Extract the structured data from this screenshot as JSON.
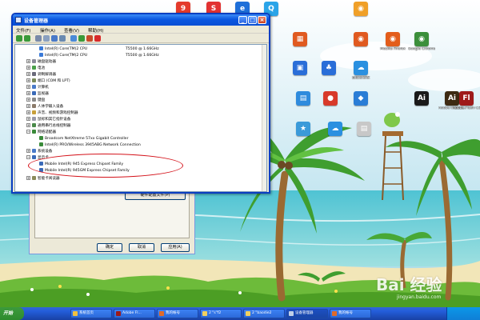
{
  "window": {
    "title": "设备管理器",
    "menu": [
      "文件(F)",
      "操作(A)",
      "查看(V)",
      "帮助(H)"
    ]
  },
  "tree": {
    "processors": [
      {
        "name": "Intel(R) Core(TM)2 CPU",
        "model": "T5500 @ 1.66GHz"
      },
      {
        "name": "Intel(R) Core(TM)2 CPU",
        "model": "T5500 @ 1.66GHz"
      }
    ],
    "categories": [
      "磁盘驱动器",
      "电池",
      "调制解调器",
      "端口 (COM 和 LPT)",
      "计算机",
      "监视器",
      "键盘",
      "人体学输入设备",
      "声音、视频和游戏控制器",
      "鼠标和其它指针设备",
      "通用串行总线控制器",
      "网络适配器"
    ],
    "network_devices": [
      "Broadcom NetXtreme 57xx Gigabit Controller",
      "Intel(R) PRO/Wireless 3945ABG Network Connection"
    ],
    "after_network": [
      "系统设备",
      "显示卡"
    ],
    "display_devices": [
      "Mobile Intel(R) 945 Express Chipset Family",
      "Mobile Intel(R) 945GM Express Chipset Family"
    ],
    "last_category": "智能卡阅读器"
  },
  "background_dialog": {
    "button_top": "硬件配置文件(P)",
    "buttons": [
      "确定",
      "取消",
      "应用(A)"
    ]
  },
  "desktop_icons": [
    {
      "label": "",
      "color": "#e43b2c",
      "glyph": "9"
    },
    {
      "label": "",
      "color": "#e23232",
      "glyph": "S"
    },
    {
      "label": "",
      "color": "#1e6fd9",
      "glyph": "e"
    },
    {
      "label": "",
      "color": "#2aa4e8",
      "glyph": "Q"
    },
    {
      "label": "",
      "color": "#f0a028",
      "glyph": "◉"
    },
    {
      "label": "",
      "color": "#e05a20",
      "glyph": "▦"
    },
    {
      "label": "",
      "color": "#e05a20",
      "glyph": "◉"
    },
    {
      "label": "Mozilla Firefox",
      "color": "#e35d1b",
      "glyph": "◉"
    },
    {
      "label": "Google Chrome",
      "color": "#3b8f3b",
      "glyph": "◉"
    },
    {
      "label": "",
      "color": "#2a6ed8",
      "glyph": "▣"
    },
    {
      "label": "",
      "color": "#2a6ed8",
      "glyph": "♣"
    },
    {
      "label": "百度云管家",
      "color": "#2a90e0",
      "glyph": "☁"
    },
    {
      "label": "",
      "color": "#2e8bdd",
      "glyph": "▤"
    },
    {
      "label": "",
      "color": "#d83a2a",
      "glyph": "●"
    },
    {
      "label": "",
      "color": "#2a7dd6",
      "glyph": "◆"
    },
    {
      "label": "",
      "color": "#1a1a1a",
      "glyph": "Ai"
    },
    {
      "label": "Adobe Illustra...",
      "color": "#3d2a12",
      "glyph": "Ai"
    },
    {
      "label": "Adobe Flash CS4 Prof...",
      "color": "#9e1a1a",
      "glyph": "Fl"
    },
    {
      "label": "",
      "color": "#3a9ad9",
      "glyph": "★"
    },
    {
      "label": "",
      "color": "#2a90e0",
      "glyph": "☁"
    },
    {
      "label": "",
      "color": "#c8c8c8",
      "glyph": "▤"
    }
  ],
  "taskbar": {
    "start_label": "开始",
    "items": [
      "系统首页",
      "Adobe Fl...",
      "我的帐号",
      "2 \"s\"f2",
      "2 \"baodie2",
      "设备管理器",
      "我的帐号"
    ]
  },
  "watermark": {
    "brand": "Bai 经验",
    "site": "jingyan.baidu.com"
  },
  "colors": {
    "xp_blue": "#0a4fd4",
    "highlight_oval": "#d4121a",
    "sea": "#5fc6d6",
    "sky": "#bfe3f2"
  }
}
